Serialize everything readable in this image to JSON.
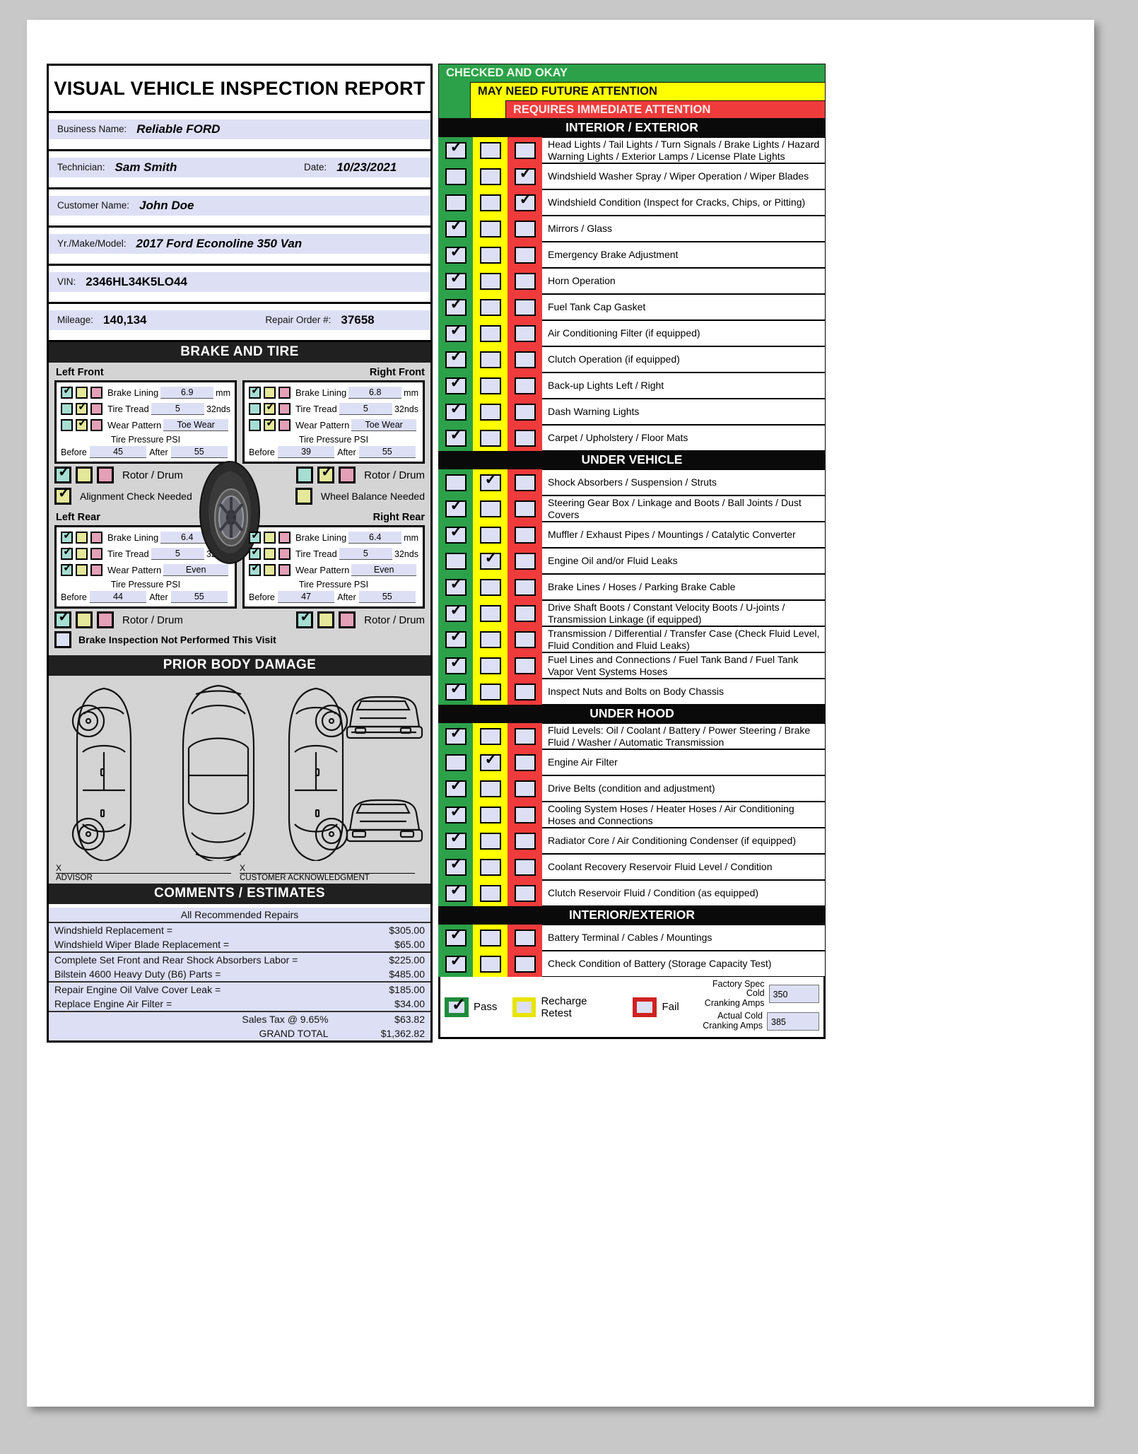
{
  "report": {
    "title": "VISUAL VEHICLE INSPECTION REPORT",
    "fields": [
      {
        "label": "Business Name:",
        "value": "Reliable FORD"
      },
      {
        "label": "Technician:",
        "value": "Sam Smith",
        "label2": "Date:",
        "value2": "10/23/2021"
      },
      {
        "label": "Customer Name:",
        "value": "John Doe"
      },
      {
        "label": "Yr./Make/Model:",
        "value": "2017 Ford Econoline 350 Van"
      },
      {
        "label": "VIN:",
        "value": "2346HL34K5LO44"
      },
      {
        "label": "Mileage:",
        "value": "140,134",
        "label2": "Repair Order #:",
        "value2": "37658"
      }
    ]
  },
  "brake_tire": {
    "heading": "BRAKE AND TIRE",
    "row_labels": {
      "lining": "Brake Lining",
      "tread": "Tire Tread",
      "wear": "Wear Pattern"
    },
    "units": {
      "lining": "mm",
      "tread": "32nds"
    },
    "pressure_label": "Tire Pressure PSI",
    "before_label": "Before",
    "after_label": "After",
    "rotor_label": "Rotor / Drum",
    "alignment_label": "Alignment Check Needed",
    "wheel_balance_label": "Wheel Balance Needed",
    "not_performed_label": "Brake Inspection Not Performed This Visit",
    "corners": [
      {
        "name": "Left Front",
        "align": "left",
        "lining": {
          "value": "6.9",
          "state": "green"
        },
        "tread": {
          "value": "5",
          "state": "yellow"
        },
        "wear": {
          "value": "Toe Wear",
          "state": "yellow"
        },
        "before": "45",
        "after": "55",
        "rotor": "green"
      },
      {
        "name": "Right Front",
        "align": "right",
        "lining": {
          "value": "6.8",
          "state": "green"
        },
        "tread": {
          "value": "5",
          "state": "yellow"
        },
        "wear": {
          "value": "Toe Wear",
          "state": "yellow"
        },
        "before": "39",
        "after": "55",
        "rotor": "yellow"
      },
      {
        "name": "Left Rear",
        "align": "left",
        "lining": {
          "value": "6.4",
          "state": "green"
        },
        "tread": {
          "value": "5",
          "state": "green"
        },
        "wear": {
          "value": "Even",
          "state": "green"
        },
        "before": "44",
        "after": "55",
        "rotor": "green"
      },
      {
        "name": "Right Rear",
        "align": "right",
        "lining": {
          "value": "6.4",
          "state": "green"
        },
        "tread": {
          "value": "5",
          "state": "green"
        },
        "wear": {
          "value": "Even",
          "state": "green"
        },
        "before": "47",
        "after": "55",
        "rotor": "green"
      }
    ],
    "alignment_checked": true,
    "wheel_balance_checked": false,
    "not_performed_checked": false
  },
  "body_damage": {
    "heading": "PRIOR BODY DAMAGE",
    "advisor_mark": "X",
    "advisor_label": "ADVISOR",
    "customer_mark": "X",
    "customer_label": "CUSTOMER ACKNOWLEDGMENT"
  },
  "comments": {
    "heading": "COMMENTS / ESTIMATES",
    "subheading": "All Recommended Repairs",
    "groups": [
      [
        {
          "desc": "Windshield Replacement =",
          "amount": "$305.00"
        },
        {
          "desc": "Windshield Wiper Blade Replacement =",
          "amount": "$65.00"
        }
      ],
      [
        {
          "desc": "Complete Set Front and Rear Shock Absorbers Labor =",
          "amount": "$225.00"
        },
        {
          "desc": "Bilstein 4600 Heavy Duty (B6) Parts =",
          "amount": "$485.00"
        }
      ],
      [
        {
          "desc": "Repair Engine Oil Valve Cover Leak =",
          "amount": "$185.00"
        },
        {
          "desc": "Replace Engine Air Filter =",
          "amount": "$34.00"
        }
      ]
    ],
    "tax_label": "Sales Tax  @   9.65%",
    "tax_amount": "$63.82",
    "total_label": "GRAND  TOTAL",
    "total_amount": "$1,362.82"
  },
  "legend": {
    "ok": "CHECKED AND OKAY",
    "future": "MAY NEED FUTURE ATTENTION",
    "immediate": "REQUIRES IMMEDIATE ATTENTION"
  },
  "sections": [
    {
      "heading": "INTERIOR / EXTERIOR",
      "items": [
        {
          "text": "Head Lights / Tail Lights / Turn Signals / Brake Lights / Hazard Warning Lights / Exterior Lamps / License Plate Lights",
          "state": "green"
        },
        {
          "text": "Windshield Washer Spray / Wiper Operation / Wiper Blades",
          "state": "red"
        },
        {
          "text": "Windshield Condition (Inspect for Cracks, Chips, or Pitting)",
          "state": "red"
        },
        {
          "text": "Mirrors / Glass",
          "state": "green"
        },
        {
          "text": "Emergency Brake Adjustment",
          "state": "green"
        },
        {
          "text": "Horn Operation",
          "state": "green"
        },
        {
          "text": "Fuel Tank Cap Gasket",
          "state": "green"
        },
        {
          "text": "Air Conditioning Filter (if equipped)",
          "state": "green"
        },
        {
          "text": "Clutch Operation (if equipped)",
          "state": "green"
        },
        {
          "text": "Back-up Lights Left / Right",
          "state": "green"
        },
        {
          "text": "Dash Warning Lights",
          "state": "green"
        },
        {
          "text": "Carpet / Upholstery / Floor Mats",
          "state": "green"
        }
      ]
    },
    {
      "heading": "UNDER VEHICLE",
      "items": [
        {
          "text": "Shock Absorbers / Suspension / Struts",
          "state": "yellow"
        },
        {
          "text": "Steering Gear Box / Linkage and Boots / Ball Joints / Dust Covers",
          "state": "green"
        },
        {
          "text": "Muffler / Exhaust Pipes / Mountings / Catalytic Converter",
          "state": "green"
        },
        {
          "text": "Engine Oil and/or Fluid Leaks",
          "state": "yellow"
        },
        {
          "text": "Brake Lines / Hoses / Parking Brake Cable",
          "state": "green"
        },
        {
          "text": "Drive Shaft Boots / Constant Velocity Boots / U-joints / Transmission Linkage (if equipped)",
          "state": "green"
        },
        {
          "text": "Transmission / Differential / Transfer Case (Check Fluid Level, Fluid Condition and Fluid Leaks)",
          "state": "green"
        },
        {
          "text": "Fuel Lines and Connections / Fuel Tank Band / Fuel Tank Vapor Vent Systems Hoses",
          "state": "green"
        },
        {
          "text": "Inspect Nuts and Bolts on Body Chassis",
          "state": "green"
        }
      ]
    },
    {
      "heading": "UNDER HOOD",
      "items": [
        {
          "text": "Fluid Levels: Oil / Coolant / Battery / Power Steering / Brake Fluid / Washer / Automatic Transmission",
          "state": "green"
        },
        {
          "text": "Engine Air Filter",
          "state": "yellow"
        },
        {
          "text": "Drive Belts (condition and adjustment)",
          "state": "green"
        },
        {
          "text": "Cooling System Hoses / Heater Hoses / Air Conditioning Hoses and Connections",
          "state": "green"
        },
        {
          "text": "Radiator Core / Air Conditioning Condenser (if equipped)",
          "state": "green"
        },
        {
          "text": "Coolant Recovery Reservoir Fluid Level / Condition",
          "state": "green"
        },
        {
          "text": "Clutch Reservoir Fluid / Condition (as equipped)",
          "state": "green"
        }
      ]
    },
    {
      "heading": "INTERIOR/EXTERIOR",
      "items": [
        {
          "text": "Battery Terminal / Cables / Mountings",
          "state": "green"
        },
        {
          "text": "Check Condition of Battery (Storage Capacity Test)",
          "state": "green"
        }
      ]
    }
  ],
  "footer": {
    "pass_label": "Pass",
    "recharge_label": "Recharge Retest",
    "fail_label": "Fail",
    "factory_label_1": "Factory Spec Cold",
    "factory_label_2": "Cranking Amps",
    "factory_value": "350",
    "actual_label_1": "Actual Cold",
    "actual_label_2": "Cranking Amps",
    "actual_value": "385"
  },
  "colors": {
    "green": "#2ca14a",
    "yellow": "#ffff00",
    "red": "#ef3b3b",
    "field_blue": "#dde0f5"
  }
}
